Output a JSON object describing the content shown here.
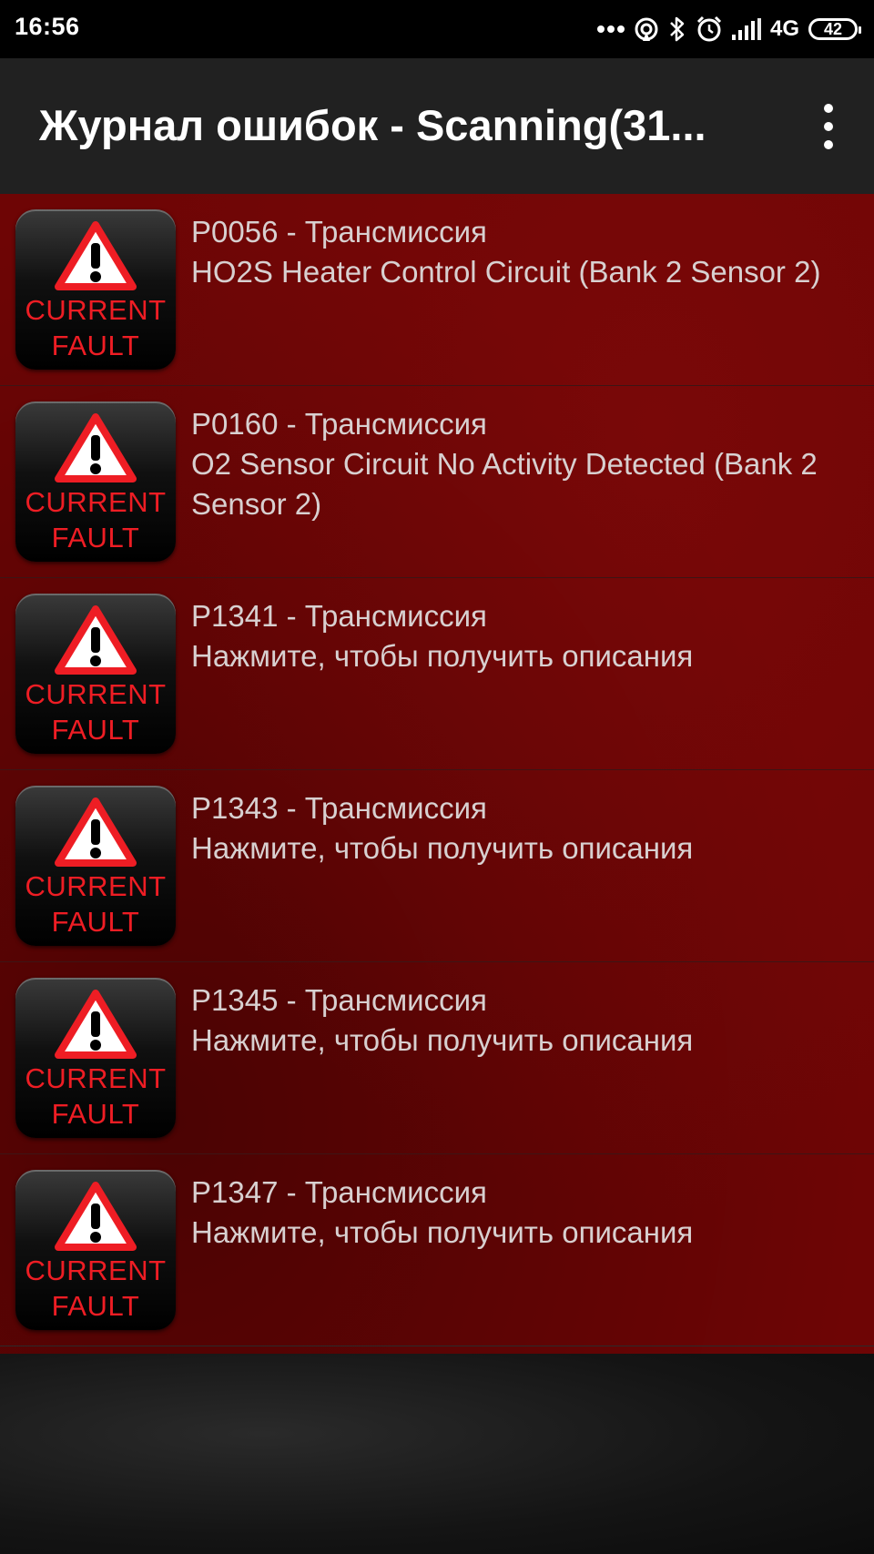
{
  "status_bar": {
    "time": "16:56",
    "network": "4G",
    "battery": "42"
  },
  "app_bar": {
    "title": "Журнал ошибок - Scanning(31..."
  },
  "badge": {
    "line1": "CURRENT",
    "line2": "FAULT"
  },
  "faults": [
    {
      "code": "P0056 - Трансмиссия",
      "description": "HO2S Heater Control Circuit (Bank 2 Sensor 2)"
    },
    {
      "code": "P0160 - Трансмиссия",
      "description": "O2 Sensor Circuit No Activity Detected (Bank 2 Sensor 2)"
    },
    {
      "code": "P1341 - Трансмиссия",
      "description": "Нажмите, чтобы получить описания"
    },
    {
      "code": "P1343 - Трансмиссия",
      "description": "Нажмите, чтобы получить описания"
    },
    {
      "code": "P1345 - Трансмиссия",
      "description": "Нажмите, чтобы получить описания"
    },
    {
      "code": "P1347 - Трансмиссия",
      "description": "Нажмите, чтобы получить описания"
    }
  ],
  "colors": {
    "list_background": "#6e0505",
    "app_bar": "#212121",
    "badge_text": "#ee1d24",
    "item_text": "#d8d0d0"
  }
}
